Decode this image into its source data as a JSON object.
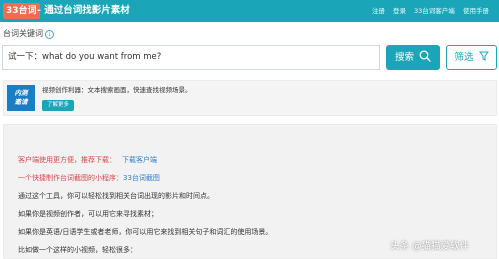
{
  "header": {
    "logo": "33台词",
    "title": "- 通过台词找影片素材",
    "nav": [
      "注册",
      "登录",
      "33台词客户端",
      "使用手册"
    ]
  },
  "search": {
    "label": "台词关键词",
    "info_icon": "i",
    "value": "试一下：what do you want from me?",
    "button": "搜索",
    "filter": "筛选"
  },
  "promo": {
    "logo_line1": "内测",
    "logo_line2": "邀请",
    "text": "视频创作利器：文本搜索画面，快速查找视频场景。",
    "button": "了解更多"
  },
  "content": {
    "line1_prefix": "客户端使用更方便，推荐下载：",
    "line1_link": "下载客户端",
    "line2_prefix": "一个快捷制作台词截图的小程序：",
    "line2_link": "33台词截图",
    "line3": "通过这个工具，你可以轻松找到相关台词出现的影片和时间点。",
    "line4": "如果你是视频创作者，可以用它来寻找素材；",
    "line5": "如果你是英语/日语学生或者老师，你可以用它来找到相关句子和词汇的使用场景。",
    "line6": "比如做一个这样的小视频，轻松很多："
  },
  "watermark": "头条 @猫猫爱软件",
  "colors": {
    "primary": "#1aa5b8",
    "logo_bg": "#f26c4f",
    "promo_logo_bg": "#1a7ec7",
    "red_text": "#e0464b",
    "link_blue": "#2f7fd0"
  }
}
